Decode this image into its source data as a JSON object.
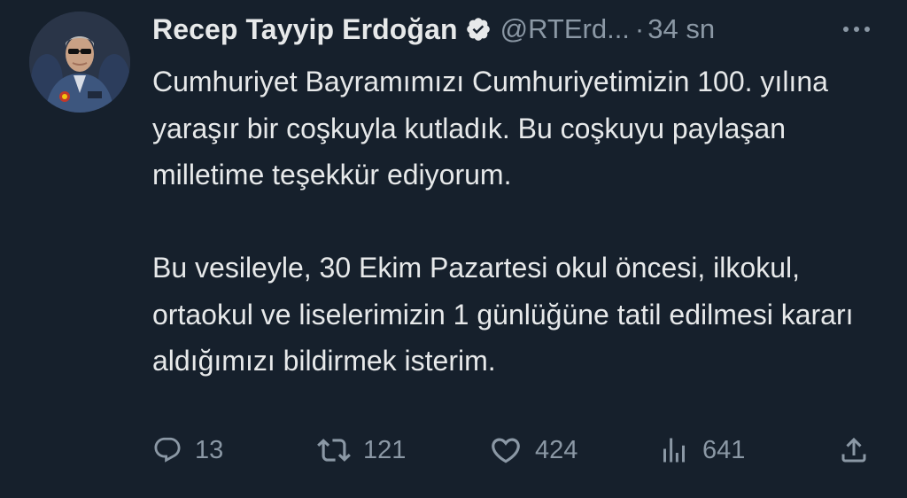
{
  "tweet": {
    "author": {
      "display_name": "Recep Tayyip Erdoğan",
      "handle": "@RTErd...",
      "verified": true,
      "avatar_icon": "profile-photo"
    },
    "separator": "·",
    "time": "34 sn",
    "more_icon": "more-horizontal-icon",
    "paragraphs": [
      "Cumhuriyet Bayramımızı Cumhuriyetimizin 100. yılına yaraşır bir coşkuyla kutladık. Bu coşkuyu paylaşan milletime teşekkür ediyorum.",
      "Bu vesileyle, 30 Ekim Pazartesi okul öncesi, ilkokul, ortaokul ve liselerimizin 1 günlüğüne tatil edilmesi kararı aldığımızı bildirmek isterim."
    ],
    "actions": {
      "reply": {
        "icon": "reply-icon",
        "count": "13"
      },
      "retweet": {
        "icon": "retweet-icon",
        "count": "121"
      },
      "like": {
        "icon": "heart-icon",
        "count": "424"
      },
      "views": {
        "icon": "views-icon",
        "count": "641"
      },
      "share": {
        "icon": "share-icon"
      }
    }
  },
  "colors": {
    "background": "#16202c",
    "primary_text": "#e7e9ea",
    "secondary_text": "#8b98a5",
    "verified_badge": "#e7e9ea"
  }
}
